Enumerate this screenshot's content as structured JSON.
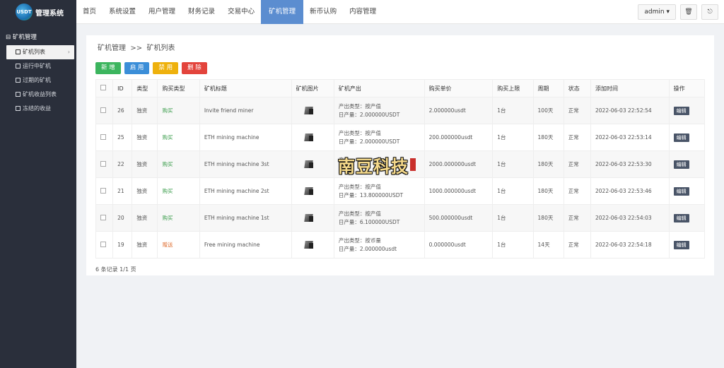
{
  "brand": {
    "logo_text": "USDT",
    "app_title": "管理系统"
  },
  "nav": {
    "items": [
      {
        "label": "首页"
      },
      {
        "label": "系统设置"
      },
      {
        "label": "用户管理"
      },
      {
        "label": "财务记录"
      },
      {
        "label": "交易中心"
      },
      {
        "label": "矿机管理",
        "active": true
      },
      {
        "label": "新币认购"
      },
      {
        "label": "内容管理"
      }
    ],
    "admin_label": "admin"
  },
  "sidebar": {
    "group_label": "矿机管理",
    "items": [
      {
        "label": "矿机列表",
        "active": true
      },
      {
        "label": "运行中矿机"
      },
      {
        "label": "过期的矿机"
      },
      {
        "label": "矿机收益列表"
      },
      {
        "label": "冻结的收益"
      }
    ]
  },
  "breadcrumb": {
    "section": "矿机管理",
    "separator": ">>",
    "page": "矿机列表"
  },
  "toolbar": {
    "add": "新 增",
    "enable": "启 用",
    "disable": "禁 用",
    "delete": "删 除"
  },
  "table": {
    "headers": [
      "ID",
      "类型",
      "购买类型",
      "矿机标题",
      "矿机图片",
      "矿机产出",
      "购买单价",
      "购买上限",
      "周期",
      "状态",
      "添加时间",
      "操作"
    ],
    "rows": [
      {
        "id": "26",
        "type": "独资",
        "buy_type": "购买",
        "title": "Invite friend miner",
        "out_type": "产出类型：按产值",
        "out_daily": "日产量：2.000000USDT",
        "price": "2.000000usdt",
        "limit": "1台",
        "period": "100天",
        "status": "正常",
        "time": "2022-06-03 22:52:54",
        "action": "编辑"
      },
      {
        "id": "25",
        "type": "独资",
        "buy_type": "购买",
        "title": "ETH mining machine",
        "out_type": "产出类型：按产值",
        "out_daily": "日产量：2.000000USDT",
        "price": "200.000000usdt",
        "limit": "1台",
        "period": "180天",
        "status": "正常",
        "time": "2022-06-03 22:53:14",
        "action": "编辑"
      },
      {
        "id": "22",
        "type": "独资",
        "buy_type": "购买",
        "title": "ETH mining machine 3st",
        "out_type": "产",
        "out_daily": "日",
        "price": "2000.000000usdt",
        "limit": "1台",
        "period": "180天",
        "status": "正常",
        "time": "2022-06-03 22:53:30",
        "action": "编辑"
      },
      {
        "id": "21",
        "type": "独资",
        "buy_type": "购买",
        "title": "ETH mining machine 2st",
        "out_type": "产出类型：按产值",
        "out_daily": "日产量：13.800000USDT",
        "price": "1000.000000usdt",
        "limit": "1台",
        "period": "180天",
        "status": "正常",
        "time": "2022-06-03 22:53:46",
        "action": "编辑"
      },
      {
        "id": "20",
        "type": "独资",
        "buy_type": "购买",
        "title": "ETH mining machine 1st",
        "out_type": "产出类型：按产值",
        "out_daily": "日产量：6.100000USDT",
        "price": "500.000000usdt",
        "limit": "1台",
        "period": "180天",
        "status": "正常",
        "time": "2022-06-03 22:54:03",
        "action": "编辑"
      },
      {
        "id": "19",
        "type": "独资",
        "buy_type": "赠送",
        "title": "Free mining machine",
        "out_type": "产出类型：按币量",
        "out_daily": "日产量：2.000000usdt",
        "price": "0.000000usdt",
        "limit": "1台",
        "period": "14天",
        "status": "正常",
        "time": "2022-06-03 22:54:18",
        "action": "编辑"
      }
    ]
  },
  "footer": {
    "record_text": "6 条记录 1/1 页"
  },
  "watermark": {
    "text": "南豆科技"
  },
  "colors": {
    "sidebar_bg": "#2a2f3b",
    "nav_active": "#5b8dd0",
    "btn_add": "#3cb55e",
    "btn_enable": "#3b8ed8",
    "btn_disable": "#eeb10d",
    "btn_delete": "#e3443c"
  },
  "icons": [
    "logo-icon",
    "dropdown-caret-icon",
    "trash-icon",
    "logout-icon",
    "menu-group-icon",
    "chevron-right-icon",
    "document-icon",
    "miner-image-icon"
  ]
}
